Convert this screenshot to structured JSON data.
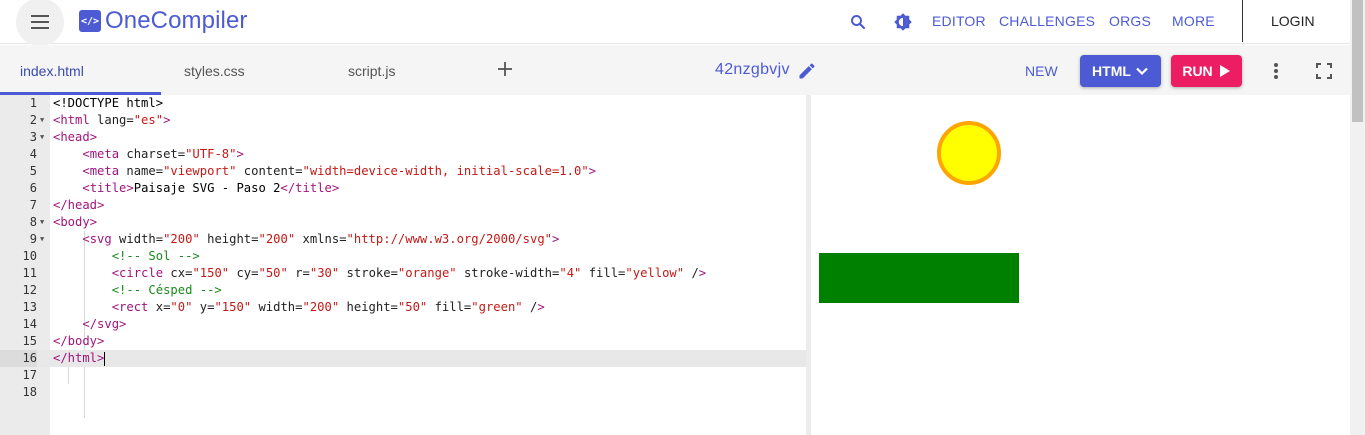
{
  "header": {
    "brand": "OneCompiler",
    "brand_icon": "code-icon",
    "nav": [
      "EDITOR",
      "CHALLENGES",
      "ORGS",
      "MORE"
    ],
    "login": "LOGIN"
  },
  "tabs": [
    {
      "label": "index.html",
      "active": true
    },
    {
      "label": "styles.css",
      "active": false
    },
    {
      "label": "script.js",
      "active": false
    }
  ],
  "toolbar": {
    "filename": "42nzgbvjv",
    "new_label": "NEW",
    "language_label": "HTML",
    "run_label": "RUN"
  },
  "editor": {
    "active_line": 16,
    "lines": [
      {
        "n": "1",
        "fold": false,
        "code": "<!DOCTYPE html>"
      },
      {
        "n": "2",
        "fold": true,
        "code": "<html lang=\"es\">"
      },
      {
        "n": "3",
        "fold": true,
        "code": "<head>"
      },
      {
        "n": "4",
        "fold": false,
        "code": "    <meta charset=\"UTF-8\">"
      },
      {
        "n": "5",
        "fold": false,
        "code": "    <meta name=\"viewport\" content=\"width=device-width, initial-scale=1.0\">"
      },
      {
        "n": "6",
        "fold": false,
        "code": "    <title>Paisaje SVG - Paso 2</title>"
      },
      {
        "n": "7",
        "fold": false,
        "code": "</head>"
      },
      {
        "n": "8",
        "fold": true,
        "code": "<body>"
      },
      {
        "n": "9",
        "fold": true,
        "code": "    <svg width=\"200\" height=\"200\" xmlns=\"http://www.w3.org/2000/svg\">"
      },
      {
        "n": "10",
        "fold": false,
        "code": "        <!-- Sol -->"
      },
      {
        "n": "11",
        "fold": false,
        "code": "        <circle cx=\"150\" cy=\"50\" r=\"30\" stroke=\"orange\" stroke-width=\"4\" fill=\"yellow\" />"
      },
      {
        "n": "12",
        "fold": false,
        "code": "        <!-- Césped -->"
      },
      {
        "n": "13",
        "fold": false,
        "code": "        <rect x=\"0\" y=\"150\" width=\"200\" height=\"50\" fill=\"green\" />"
      },
      {
        "n": "14",
        "fold": false,
        "code": "    </svg>"
      },
      {
        "n": "15",
        "fold": false,
        "code": "</body>"
      },
      {
        "n": "16",
        "fold": false,
        "code": "</html>"
      },
      {
        "n": "17",
        "fold": false,
        "code": ""
      },
      {
        "n": "18",
        "fold": false,
        "code": ""
      }
    ]
  },
  "colors": {
    "brand": "#4c5bd4",
    "run": "#ec1d63",
    "tag": "#a0157e",
    "string": "#c41a16",
    "comment": "#1a8a1a",
    "sun_fill": "yellow",
    "sun_stroke": "orange",
    "grass": "green"
  }
}
